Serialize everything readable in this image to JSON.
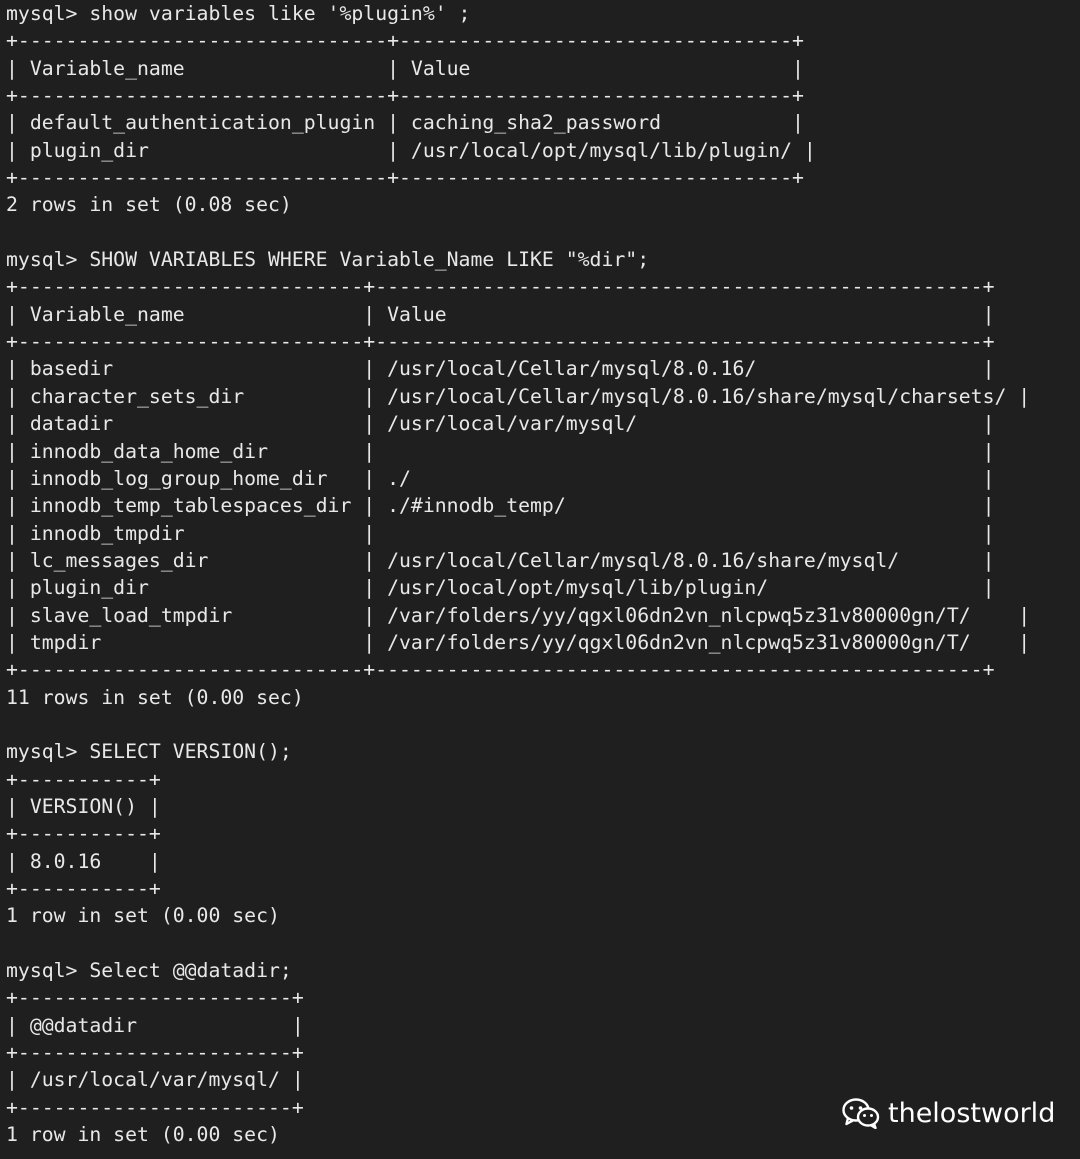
{
  "terminal": {
    "lines": [
      "mysql> show variables like '%plugin%' ;",
      "+-------------------------------+---------------------------------+",
      "| Variable_name                 | Value                           |",
      "+-------------------------------+---------------------------------+",
      "| default_authentication_plugin | caching_sha2_password           |",
      "| plugin_dir                    | /usr/local/opt/mysql/lib/plugin/ |",
      "+-------------------------------+---------------------------------+",
      "2 rows in set (0.08 sec)",
      "",
      "mysql> SHOW VARIABLES WHERE Variable_Name LIKE \"%dir\";",
      "+-----------------------------+---------------------------------------------------+",
      "| Variable_name               | Value                                             |",
      "+-----------------------------+---------------------------------------------------+",
      "| basedir                     | /usr/local/Cellar/mysql/8.0.16/                   |",
      "| character_sets_dir          | /usr/local/Cellar/mysql/8.0.16/share/mysql/charsets/ |",
      "| datadir                     | /usr/local/var/mysql/                             |",
      "| innodb_data_home_dir        |                                                   |",
      "| innodb_log_group_home_dir   | ./                                                |",
      "| innodb_temp_tablespaces_dir | ./#innodb_temp/                                   |",
      "| innodb_tmpdir               |                                                   |",
      "| lc_messages_dir             | /usr/local/Cellar/mysql/8.0.16/share/mysql/       |",
      "| plugin_dir                  | /usr/local/opt/mysql/lib/plugin/                  |",
      "| slave_load_tmpdir           | /var/folders/yy/qgxl06dn2vn_nlcpwq5z31v80000gn/T/    |",
      "| tmpdir                      | /var/folders/yy/qgxl06dn2vn_nlcpwq5z31v80000gn/T/    |",
      "+-----------------------------+---------------------------------------------------+",
      "11 rows in set (0.00 sec)",
      "",
      "mysql> SELECT VERSION();",
      "+-----------+",
      "| VERSION() |",
      "+-----------+",
      "| 8.0.16    |",
      "+-----------+",
      "1 row in set (0.00 sec)",
      "",
      "mysql> Select @@datadir;",
      "+-----------------------+",
      "| @@datadir             |",
      "+-----------------------+",
      "| /usr/local/var/mysql/ |",
      "+-----------------------+",
      "1 row in set (0.00 sec)"
    ]
  },
  "watermark": {
    "icon": "wechat-icon",
    "text": "thelostworld",
    "color": "#ffffff"
  },
  "colors": {
    "background": "#1f1f1f",
    "text": "#e8e8e8"
  }
}
